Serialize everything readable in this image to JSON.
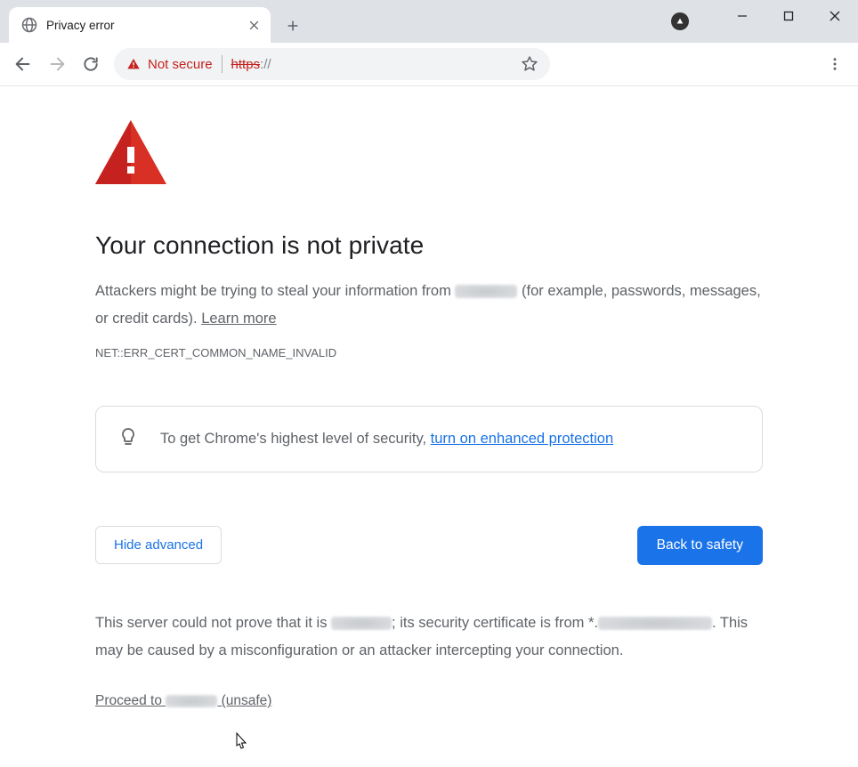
{
  "window": {
    "tab_title": "Privacy error"
  },
  "omnibox": {
    "security_label": "Not secure",
    "url_scheme": "https",
    "url_separator": "://"
  },
  "interstitial": {
    "headline": "Your connection is not private",
    "body_prefix": "Attackers might be trying to steal your information from ",
    "body_suffix": " (for example, passwords, messages, or credit cards). ",
    "learn_more_label": "Learn more",
    "error_code": "NET::ERR_CERT_COMMON_NAME_INVALID",
    "promo_prefix": "To get Chrome's highest level of security, ",
    "promo_link": "turn on enhanced protection",
    "hide_advanced_label": "Hide advanced",
    "back_to_safety_label": "Back to safety",
    "adv_part1": "This server could not prove that it is ",
    "adv_part2": "; its security certificate is from *.",
    "adv_part3": ". This may be caused by a misconfiguration or an attacker intercepting your connection.",
    "proceed_prefix": "Proceed to ",
    "proceed_suffix": " (unsafe)"
  }
}
